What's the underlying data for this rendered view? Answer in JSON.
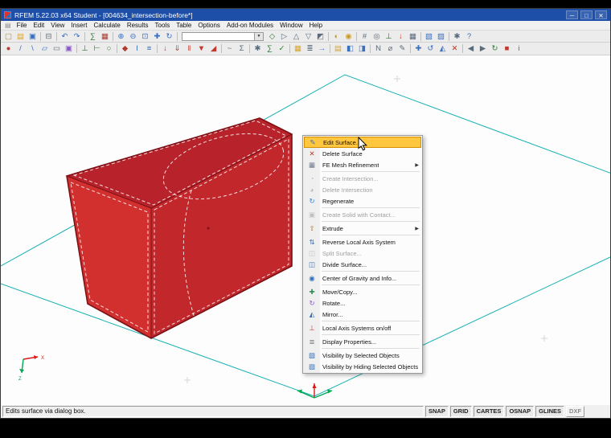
{
  "colors": {
    "titlebar": "#1d4fa8",
    "titlebar_text": "#ffffff",
    "menu_bg": "#f0f0f0",
    "toolbar_bg": "#ececec",
    "viewport_bg": "#fdfdfd",
    "face_top": "#b8232b",
    "face_left": "#d2302f",
    "face_right": "#c1272b",
    "edge": "#7c1116",
    "selection_dash": "#ffffff",
    "guide": "#17b0b4",
    "highlight": "#ffc63f",
    "axis_red": "#e01616",
    "axis_green": "#00a651",
    "status_bg": "#f0f0f0"
  },
  "window": {
    "title": "RFEM 5.22.03 x64 Student - [004634_intersection-before*]",
    "controls": {
      "minimize": "─",
      "maximize": "□",
      "close": "✕"
    }
  },
  "menu_bar": {
    "items": [
      "File",
      "Edit",
      "View",
      "Insert",
      "Calculate",
      "Results",
      "Tools",
      "Table",
      "Options",
      "Add-on Modules",
      "Window",
      "Help"
    ]
  },
  "toolbar_main": {
    "items": [
      {
        "type": "icon",
        "name": "new-file-icon",
        "glyph": "▢",
        "color": "#b78b2e"
      },
      {
        "type": "icon",
        "name": "open-file-icon",
        "glyph": "▤",
        "color": "#d9a62e"
      },
      {
        "type": "icon",
        "name": "save-icon",
        "glyph": "▣",
        "color": "#3a6fc0"
      },
      {
        "type": "sep"
      },
      {
        "type": "icon",
        "name": "print-icon",
        "glyph": "⊟",
        "color": "#5a6b7c"
      },
      {
        "type": "sep"
      },
      {
        "type": "icon",
        "name": "undo-icon",
        "glyph": "↶",
        "color": "#3a6fc0"
      },
      {
        "type": "icon",
        "name": "redo-icon",
        "glyph": "↷",
        "color": "#3a6fc0"
      },
      {
        "type": "sep"
      },
      {
        "type": "icon",
        "name": "calculate-icon",
        "glyph": "∑",
        "color": "#2e7d32"
      },
      {
        "type": "icon",
        "name": "results-icon",
        "glyph": "▦",
        "color": "#b03a2e"
      },
      {
        "type": "sep"
      },
      {
        "type": "icon",
        "name": "zoom-in-icon",
        "glyph": "⊕",
        "color": "#3a6fc0"
      },
      {
        "type": "icon",
        "name": "zoom-out-icon",
        "glyph": "⊖",
        "color": "#3a6fc0"
      },
      {
        "type": "icon",
        "name": "zoom-window-icon",
        "glyph": "⊡",
        "color": "#3a6fc0"
      },
      {
        "type": "icon",
        "name": "pan-icon",
        "glyph": "✚",
        "color": "#3a6fc0"
      },
      {
        "type": "icon",
        "name": "rotate-view-icon",
        "glyph": "↻",
        "color": "#3a6fc0"
      },
      {
        "type": "sep"
      },
      {
        "type": "combo",
        "name": "selection-combobox",
        "value": ""
      },
      {
        "type": "icon",
        "name": "isometric-view-icon",
        "glyph": "◇",
        "color": "#2e7d32"
      },
      {
        "type": "icon",
        "name": "view-x-icon",
        "glyph": "▷",
        "color": "#5a6b7c"
      },
      {
        "type": "icon",
        "name": "view-y-icon",
        "glyph": "△",
        "color": "#5a6b7c"
      },
      {
        "type": "icon",
        "name": "view-z-icon",
        "glyph": "▽",
        "color": "#5a6b7c"
      },
      {
        "type": "icon",
        "name": "perspective-view-icon",
        "glyph": "◩",
        "color": "#5a6b7c"
      },
      {
        "type": "sep"
      },
      {
        "type": "icon",
        "name": "rendering-icon",
        "glyph": "◐",
        "color": "#c79a2e"
      },
      {
        "type": "icon",
        "name": "lighting-icon",
        "glyph": "◉",
        "color": "#c79a2e"
      },
      {
        "type": "sep"
      },
      {
        "type": "icon",
        "name": "grid-icon",
        "glyph": "#",
        "color": "#5a6b7c"
      },
      {
        "type": "icon",
        "name": "snap-icon",
        "glyph": "◎",
        "color": "#5a6b7c"
      },
      {
        "type": "icon",
        "name": "supports-display-icon",
        "glyph": "⊥",
        "color": "#2e7d32"
      },
      {
        "type": "icon",
        "name": "loads-display-icon",
        "glyph": "↓",
        "color": "#c0392b"
      },
      {
        "type": "icon",
        "name": "fe-mesh-display-icon",
        "glyph": "▦",
        "color": "#5a6b7c"
      },
      {
        "type": "sep"
      },
      {
        "type": "icon",
        "name": "visibility-icon",
        "glyph": "▧",
        "color": "#3a6fc0"
      },
      {
        "type": "icon",
        "name": "clipping-icon",
        "glyph": "▨",
        "color": "#3a6fc0"
      },
      {
        "type": "sep"
      },
      {
        "type": "icon",
        "name": "settings-icon",
        "glyph": "✱",
        "color": "#5a6b7c"
      },
      {
        "type": "icon",
        "name": "help-icon",
        "glyph": "?",
        "color": "#3a6fc0"
      }
    ]
  },
  "toolbar_secondary": {
    "items": [
      {
        "type": "icon",
        "name": "new-node-icon",
        "glyph": "●",
        "color": "#c0392b"
      },
      {
        "type": "icon",
        "name": "new-line-icon",
        "glyph": "/",
        "color": "#3a6fc0"
      },
      {
        "type": "icon",
        "name": "new-member-icon",
        "glyph": "\\",
        "color": "#3a6fc0"
      },
      {
        "type": "icon",
        "name": "new-surface-icon",
        "glyph": "▱",
        "color": "#3a6fc0"
      },
      {
        "type": "icon",
        "name": "new-opening-icon",
        "glyph": "▭",
        "color": "#5a6b7c"
      },
      {
        "type": "icon",
        "name": "new-solid-icon",
        "glyph": "▣",
        "color": "#8a56c8"
      },
      {
        "type": "sep"
      },
      {
        "type": "icon",
        "name": "nodal-support-icon",
        "glyph": "⊥",
        "color": "#2e7d32"
      },
      {
        "type": "icon",
        "name": "line-support-icon",
        "glyph": "⊢",
        "color": "#2e7d32"
      },
      {
        "type": "icon",
        "name": "member-hinge-icon",
        "glyph": "○",
        "color": "#2e7d32"
      },
      {
        "type": "sep"
      },
      {
        "type": "icon",
        "name": "material-icon",
        "glyph": "◆",
        "color": "#b03a2e"
      },
      {
        "type": "icon",
        "name": "cross-section-icon",
        "glyph": "I",
        "color": "#3a6fc0"
      },
      {
        "type": "icon",
        "name": "thickness-icon",
        "glyph": "≡",
        "color": "#3a6fc0"
      },
      {
        "type": "sep"
      },
      {
        "type": "icon",
        "name": "load-case-icon",
        "glyph": "↓",
        "color": "#c0392b"
      },
      {
        "type": "icon",
        "name": "nodal-load-icon",
        "glyph": "⇓",
        "color": "#c0392b"
      },
      {
        "type": "icon",
        "name": "line-load-icon",
        "glyph": "‖",
        "color": "#c0392b"
      },
      {
        "type": "icon",
        "name": "surface-load-icon",
        "glyph": "▼",
        "color": "#c0392b"
      },
      {
        "type": "icon",
        "name": "free-load-icon",
        "glyph": "◢",
        "color": "#c0392b"
      },
      {
        "type": "sep"
      },
      {
        "type": "icon",
        "name": "imperfection-icon",
        "glyph": "~",
        "color": "#5a6b7c"
      },
      {
        "type": "icon",
        "name": "load-combination-icon",
        "glyph": "Σ",
        "color": "#5a6b7c"
      },
      {
        "type": "sep"
      },
      {
        "type": "icon",
        "name": "calculation-params-icon",
        "glyph": "✱",
        "color": "#5a6b7c"
      },
      {
        "type": "icon",
        "name": "calculate-all-icon",
        "glyph": "∑",
        "color": "#2e7d32"
      },
      {
        "type": "icon",
        "name": "check-model-icon",
        "glyph": "✓",
        "color": "#2e7d32"
      },
      {
        "type": "sep"
      },
      {
        "type": "icon",
        "name": "results-table-icon",
        "glyph": "▦",
        "color": "#d9a62e"
      },
      {
        "type": "icon",
        "name": "printout-report-icon",
        "glyph": "≣",
        "color": "#5a6b7c"
      },
      {
        "type": "icon",
        "name": "export-icon",
        "glyph": "→",
        "color": "#3a6fc0"
      },
      {
        "type": "sep"
      },
      {
        "type": "icon",
        "name": "tables-icon",
        "glyph": "▤",
        "color": "#d9a62e"
      },
      {
        "type": "icon",
        "name": "navigator-icon",
        "glyph": "◧",
        "color": "#3a6fc0"
      },
      {
        "type": "icon",
        "name": "panel-icon",
        "glyph": "◨",
        "color": "#3a6fc0"
      },
      {
        "type": "sep"
      },
      {
        "type": "icon",
        "name": "renumber-icon",
        "glyph": "N",
        "color": "#5a6b7c"
      },
      {
        "type": "icon",
        "name": "measure-icon",
        "glyph": "⌀",
        "color": "#5a6b7c"
      },
      {
        "type": "icon",
        "name": "comment-icon",
        "glyph": "✎",
        "color": "#5a6b7c"
      },
      {
        "type": "sep"
      },
      {
        "type": "icon",
        "name": "move-objects-icon",
        "glyph": "✚",
        "color": "#3a6fc0"
      },
      {
        "type": "icon",
        "name": "rotate-objects-icon",
        "glyph": "↺",
        "color": "#3a6fc0"
      },
      {
        "type": "icon",
        "name": "mirror-objects-icon",
        "glyph": "◭",
        "color": "#3a6fc0"
      },
      {
        "type": "icon",
        "name": "delete-objects-icon",
        "glyph": "✕",
        "color": "#c0392b"
      },
      {
        "type": "sep"
      },
      {
        "type": "icon",
        "name": "previous-view-icon",
        "glyph": "◀",
        "color": "#5a6b7c"
      },
      {
        "type": "icon",
        "name": "next-view-icon",
        "glyph": "▶",
        "color": "#5a6b7c"
      },
      {
        "type": "icon",
        "name": "refresh-icon",
        "glyph": "↻",
        "color": "#2e7d32"
      },
      {
        "type": "icon",
        "name": "stop-icon",
        "glyph": "■",
        "color": "#c0392b"
      },
      {
        "type": "icon",
        "name": "info-icon",
        "glyph": "i",
        "color": "#3a6fc0"
      }
    ]
  },
  "viewport": {
    "axis_triad": {
      "x_label": "X",
      "z_label": "Z"
    }
  },
  "context_menu": {
    "items": [
      {
        "type": "item",
        "label": "Edit Surface...",
        "icon": "edit-surface-icon",
        "glyph": "✎",
        "color": "#2f6fb8",
        "highlighted": true
      },
      {
        "type": "item",
        "label": "Delete Surface",
        "icon": "delete-surface-icon",
        "glyph": "✕",
        "color": "#c0392b"
      },
      {
        "type": "item",
        "label": "FE Mesh Refinement",
        "icon": "fe-mesh-refinement-icon",
        "glyph": "▦",
        "color": "#6b7b8c",
        "submenu": true
      },
      {
        "type": "separator"
      },
      {
        "type": "item",
        "label": "Create Intersection...",
        "icon": "create-intersection-icon",
        "glyph": "◔",
        "color": "#888888",
        "disabled": true
      },
      {
        "type": "item",
        "label": "Delete Intersection",
        "icon": "delete-intersection-icon",
        "glyph": "◕",
        "color": "#888888",
        "disabled": true
      },
      {
        "type": "item",
        "label": "Regenerate",
        "icon": "regenerate-icon",
        "glyph": "↻",
        "color": "#2e7fd4"
      },
      {
        "type": "separator"
      },
      {
        "type": "item",
        "label": "Create Solid with Contact...",
        "icon": "create-solid-with-contact-icon",
        "glyph": "▣",
        "color": "#888888",
        "disabled": true
      },
      {
        "type": "separator"
      },
      {
        "type": "item",
        "label": "Extrude",
        "icon": "extrude-icon",
        "glyph": "⇧",
        "color": "#b0722a",
        "submenu": true
      },
      {
        "type": "separator"
      },
      {
        "type": "item",
        "label": "Reverse Local Axis System",
        "icon": "reverse-local-axis-icon",
        "glyph": "⇅",
        "color": "#2f6fb8"
      },
      {
        "type": "item",
        "label": "Split Surface...",
        "icon": "split-surface-icon",
        "glyph": "◫",
        "color": "#888888",
        "disabled": true
      },
      {
        "type": "item",
        "label": "Divide Surface...",
        "icon": "divide-surface-icon",
        "glyph": "◫",
        "color": "#2f6fb8"
      },
      {
        "type": "separator"
      },
      {
        "type": "item",
        "label": "Center of Gravity and Info...",
        "icon": "center-of-gravity-icon",
        "glyph": "◉",
        "color": "#2f6fb8"
      },
      {
        "type": "separator"
      },
      {
        "type": "item",
        "label": "Move/Copy...",
        "icon": "move-copy-icon",
        "glyph": "✚",
        "color": "#2e8b57"
      },
      {
        "type": "item",
        "label": "Rotate...",
        "icon": "rotate-icon",
        "glyph": "↻",
        "color": "#8a56c8"
      },
      {
        "type": "item",
        "label": "Mirror...",
        "icon": "mirror-icon",
        "glyph": "◭",
        "color": "#2f6fb8"
      },
      {
        "type": "separator"
      },
      {
        "type": "item",
        "label": "Local Axis Systems on/off",
        "icon": "local-axis-systems-icon",
        "glyph": "⊥",
        "color": "#c0392b"
      },
      {
        "type": "separator"
      },
      {
        "type": "item",
        "label": "Display Properties...",
        "icon": "display-properties-icon",
        "glyph": "≣",
        "color": "#555555"
      },
      {
        "type": "separator"
      },
      {
        "type": "item",
        "label": "Visibility by Selected Objects",
        "icon": "visibility-selected-icon",
        "glyph": "▧",
        "color": "#2f6fb8"
      },
      {
        "type": "item",
        "label": "Visibility by Hiding Selected Objects",
        "icon": "visibility-hiding-icon",
        "glyph": "▨",
        "color": "#2f6fb8"
      }
    ]
  },
  "status_bar": {
    "message": "Edits surface via dialog box.",
    "toggles": [
      {
        "label": "SNAP",
        "active": true
      },
      {
        "label": "GRID",
        "active": true
      },
      {
        "label": "CARTES",
        "active": true
      },
      {
        "label": "OSNAP",
        "active": true
      },
      {
        "label": "GLINES",
        "active": true
      },
      {
        "label": "DXF",
        "active": false
      }
    ]
  }
}
